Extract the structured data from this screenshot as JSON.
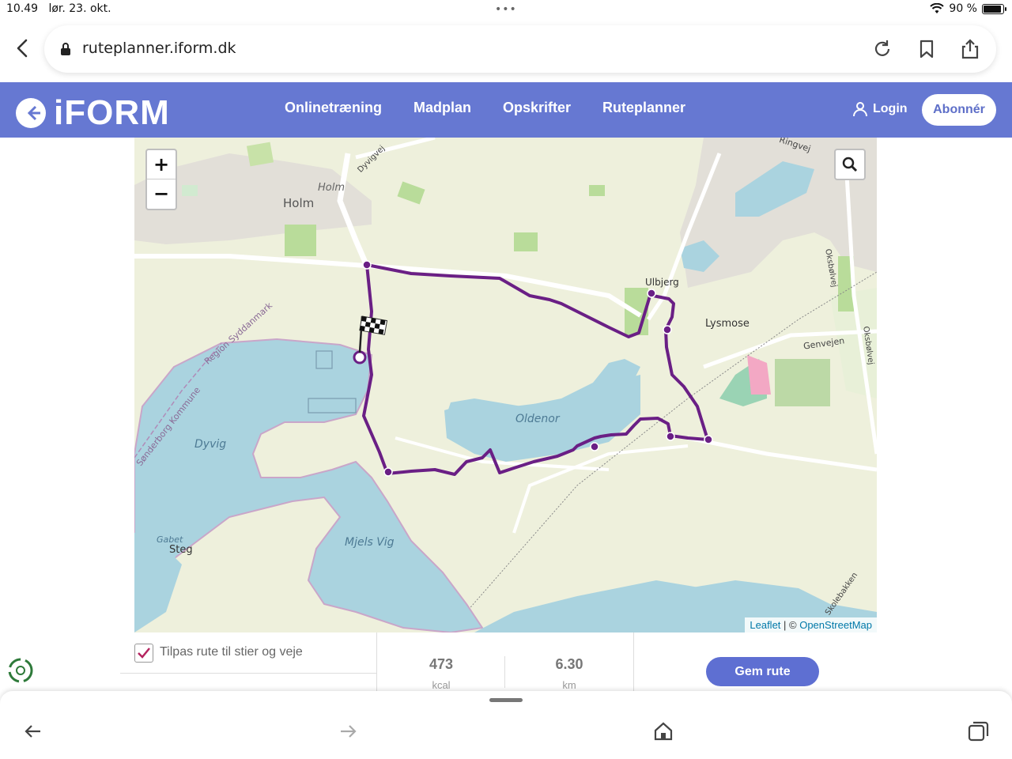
{
  "status_bar": {
    "time": "10.49",
    "date": "lør. 23. okt.",
    "battery": "90 %",
    "battery_level": 0.9
  },
  "browser": {
    "url": "ruteplanner.iform.dk"
  },
  "site": {
    "logo": "iFORM",
    "nav": [
      "Onlinetræning",
      "Madplan",
      "Opskrifter",
      "Ruteplanner"
    ],
    "login": "Login",
    "subscribe": "Abonnér"
  },
  "map": {
    "zoom_in": "+",
    "zoom_out": "−",
    "labels": {
      "holm": "Holm",
      "holm_small": "Holm",
      "dyvigvej": "Dyvigvej",
      "ringvej": "Ringvej",
      "ulbjerg": "Ulbjerg",
      "lysmose": "Lysmose",
      "genvejen": "Genvejen",
      "oksbolvej1": "Oksbølvej",
      "oksbolvej2": "Oksbølvej",
      "region": "Region Syddanmark",
      "kommune": "Sønderborg Kommune",
      "dyvig": "Dyvig",
      "oldenor": "Oldenor",
      "mjels_vig": "Mjels Vig",
      "gabet": "Gabet",
      "steg": "Steg",
      "skolebakken": "Skolebakken"
    },
    "attribution": {
      "leaflet": "Leaflet",
      "sep": " | © ",
      "osm": "OpenStreetMap"
    }
  },
  "route_panel": {
    "adapt_label": "Tilpas rute til stier og veje",
    "adapt_checked": true,
    "calories_value": "473",
    "calories_unit": "kcal",
    "distance_value": "6.30",
    "distance_unit": "km",
    "save_button": "Gem rute"
  },
  "colors": {
    "brand": "#6678d2",
    "route": "#6a1f85",
    "water": "#aad3df"
  }
}
